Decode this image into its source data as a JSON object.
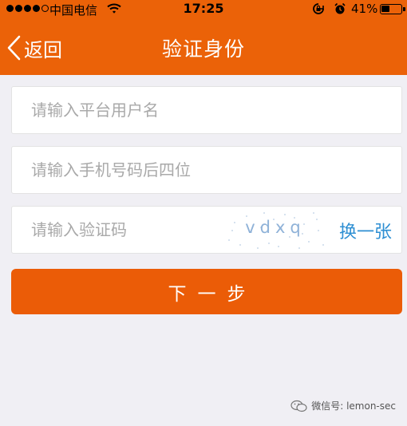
{
  "status_bar": {
    "carrier": "中国电信",
    "time": "17:25",
    "battery": "41%",
    "icons": [
      "signal-dots",
      "wifi-icon",
      "lock-rotation-icon",
      "alarm-icon",
      "battery-icon"
    ]
  },
  "nav": {
    "back_label": "返回",
    "title": "验证身份"
  },
  "form": {
    "username_placeholder": "请输入平台用户名",
    "phone_placeholder": "请输入手机号码后四位",
    "captcha_placeholder": "请输入验证码",
    "captcha_text": "vdxq",
    "refresh_label": "换一张"
  },
  "next_button": "下一步",
  "watermark": "微信号: lemon-sec",
  "colors": {
    "brand_orange": "#eb6208",
    "link_blue": "#2e8fd3",
    "background": "#f0eff4"
  }
}
